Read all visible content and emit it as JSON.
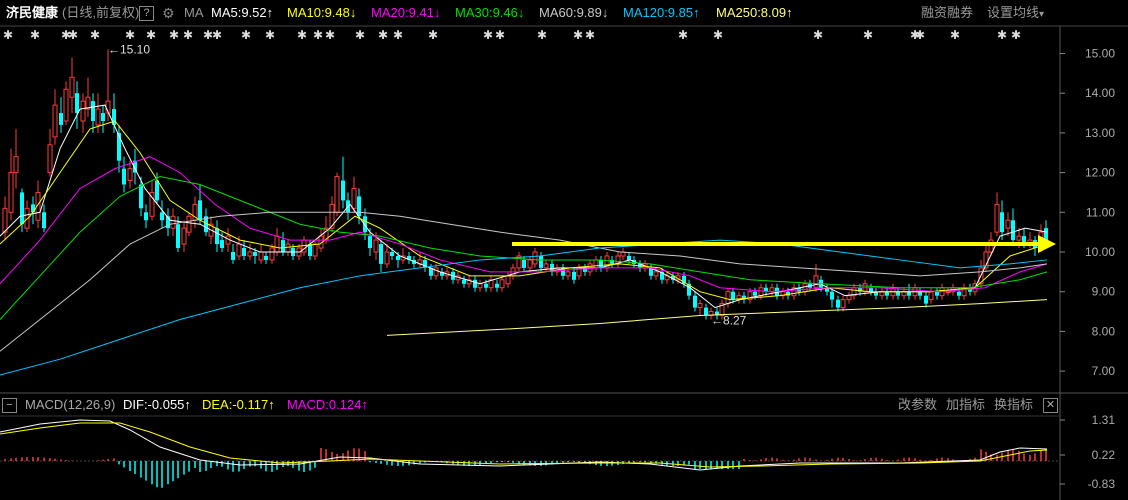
{
  "header": {
    "stock_name": "济民健康",
    "period_info": "(日线,前复权)",
    "help_label": "?",
    "gear_icon": "gear-icon",
    "ma_label": "MA",
    "indicators": [
      {
        "text": "MA5:9.52",
        "arrow": "↑",
        "color": "#ffffff"
      },
      {
        "text": "MA10:9.48",
        "arrow": "↓",
        "color": "#ffff00"
      },
      {
        "text": "MA20:9.41",
        "arrow": "↓",
        "color": "#ff00ff"
      },
      {
        "text": "MA30:9.46",
        "arrow": "↓",
        "color": "#00e000"
      },
      {
        "text": "MA60:9.89",
        "arrow": "↓",
        "color": "#c8c8c8"
      },
      {
        "text": "MA120:9.85",
        "arrow": "↑",
        "color": "#00c8ff"
      },
      {
        "text": "MA250:8.09",
        "arrow": "↑",
        "color": "#ffff80"
      }
    ],
    "margin_trading": "融资融券",
    "set_ma": "设置均线",
    "set_ma_caret": "▾"
  },
  "price_axis": [
    "15.00",
    "14.00",
    "13.00",
    "12.00",
    "11.00",
    "10.00",
    "9.00",
    "8.00",
    "7.00"
  ],
  "annotations": {
    "high": "←15.10",
    "low": "←8.27"
  },
  "macd": {
    "collapse_label": "−",
    "name": "MACD(12,26,9)",
    "dif": "DIF:-0.055",
    "dif_arrow": "↑",
    "dea": "DEA:-0.117",
    "dea_arrow": "↑",
    "macd": "MACD:0.124",
    "macd_arrow": "↑",
    "buttons": [
      "改参数",
      "加指标",
      "换指标"
    ],
    "close_label": "✕",
    "axis": [
      "1.31",
      "0.22",
      "-0.83"
    ]
  },
  "colors": {
    "up": "#ff3b3b",
    "down": "#00ffff",
    "arrow": "#ffff00",
    "grid": "#333333"
  },
  "chart_data": {
    "type": "candlestick",
    "price_range": [
      6.7,
      15.4
    ],
    "annotated_high": 15.1,
    "annotated_low": 8.27,
    "trend_arrow_level": 10.2
  }
}
